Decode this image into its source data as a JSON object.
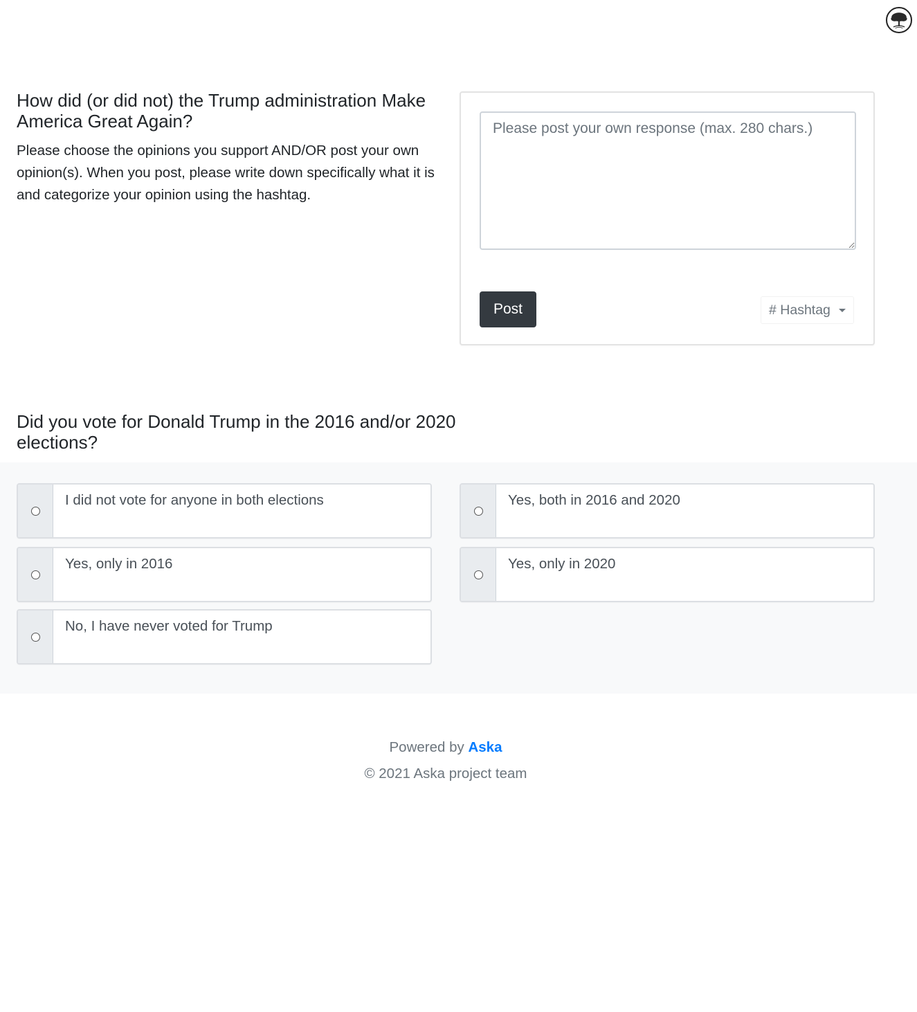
{
  "header": {
    "avatar_icon": "tree-logo-icon"
  },
  "question1": {
    "title": "How did (or did not) the Trump administration Make America Great Again?",
    "description": "Please choose the opinions you support AND/OR post your own opinion(s). When you post, please write down specifically what it is and categorize your opinion using the hashtag."
  },
  "post_form": {
    "placeholder": "Please post your own response (max. 280 chars.)",
    "value": "",
    "post_label": "Post",
    "hashtag_label": "# Hashtag"
  },
  "question2": {
    "title": "Did you vote for Donald Trump in the 2016 and/or 2020 elections?",
    "options": [
      "I did not vote for anyone in both elections",
      "Yes, both in 2016 and 2020",
      "Yes, only in 2016",
      "Yes, only in 2020",
      "No, I have never voted for Trump"
    ]
  },
  "footer": {
    "powered_prefix": "Powered by",
    "brand": "Aska",
    "copyright": "© 2021 Aska project team"
  },
  "colors": {
    "primary_button": "#343a40",
    "link": "#007bff",
    "panel_bg": "#f8f9fa"
  }
}
